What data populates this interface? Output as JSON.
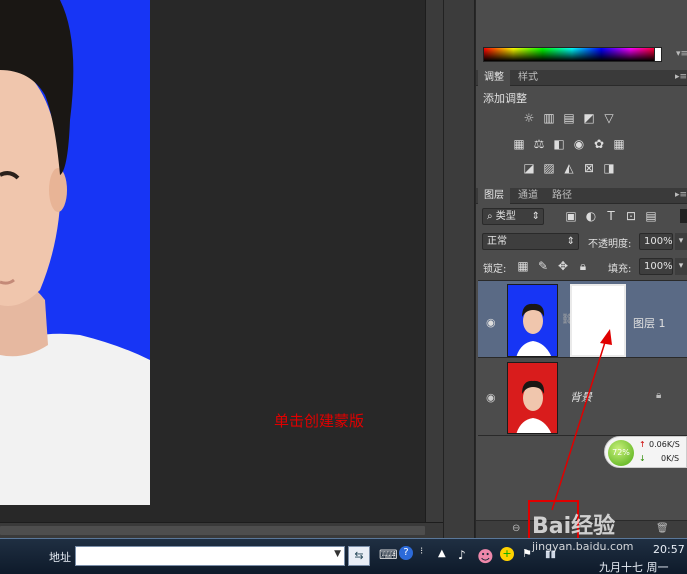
{
  "adjust_panel": {
    "tab_active": "调整",
    "tab_other": "样式",
    "title": "添加调整",
    "row1_icons": [
      "brightness-icon",
      "levels-icon",
      "curves-icon",
      "exposure-icon",
      "vibrance-icon"
    ],
    "row2_icons": [
      "hue-sat-icon",
      "color-balance-icon",
      "bw-icon",
      "photo-filter-icon",
      "channel-mixer-icon",
      "color-lookup-icon"
    ],
    "row3_icons": [
      "invert-icon",
      "posterize-icon",
      "threshold-icon",
      "selective-color-icon",
      "gradient-map-icon"
    ]
  },
  "layers_panel": {
    "tabs": [
      "图层",
      "通道",
      "路径"
    ],
    "filter_label": "类型",
    "blend_mode": "正常",
    "opacity_label": "不透明度:",
    "opacity_value": "100%",
    "lock_label": "锁定:",
    "fill_label": "填充:",
    "fill_value": "100%",
    "layers": [
      {
        "name": "图层 1",
        "selected": true,
        "has_mask": true
      },
      {
        "name": "背景",
        "selected": false,
        "locked": true
      }
    ]
  },
  "annotation": {
    "text": "单击创建蒙版"
  },
  "network_widget": {
    "percent": "72%",
    "up_speed": "0.06K/S",
    "down_speed": "0K/S"
  },
  "taskbar": {
    "address_label": "地址",
    "address_value": "",
    "time": "20:57",
    "date": "九月十七 周一",
    "watermark_text": "Bai经验",
    "watermark_url": "jingyan.baidu.com"
  },
  "colors": {
    "photo_bg_blue": "#1735f5",
    "photo_bg_red": "#d91c1c",
    "annotation_red": "#e00000",
    "selected_layer": "#5a6a85"
  }
}
